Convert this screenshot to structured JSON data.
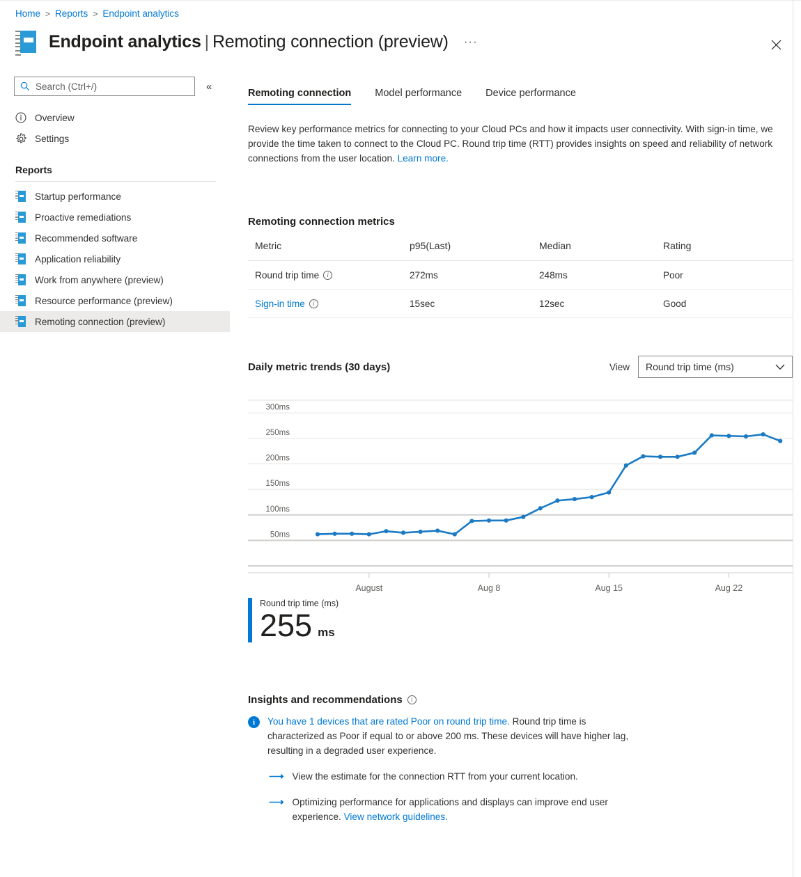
{
  "breadcrumb": [
    "Home",
    "Reports",
    "Endpoint analytics"
  ],
  "header": {
    "title": "Endpoint analytics",
    "separator": "|",
    "subtitle": "Remoting connection (preview)",
    "more_label": "···",
    "app_icon": "notebook-icon",
    "close_icon": "close-icon"
  },
  "sidebar": {
    "search": {
      "placeholder": "Search (Ctrl+/)",
      "value": "",
      "icon": "search-icon"
    },
    "collapse_label": "«",
    "top_items": [
      {
        "label": "Overview",
        "icon": "info-circle-icon"
      },
      {
        "label": "Settings",
        "icon": "gear-icon"
      }
    ],
    "section_title": "Reports",
    "report_items": [
      {
        "label": "Startup performance",
        "selected": false
      },
      {
        "label": "Proactive remediations",
        "selected": false
      },
      {
        "label": "Recommended software",
        "selected": false
      },
      {
        "label": "Application reliability",
        "selected": false
      },
      {
        "label": "Work from anywhere (preview)",
        "selected": false
      },
      {
        "label": "Resource performance (preview)",
        "selected": false
      },
      {
        "label": "Remoting connection (preview)",
        "selected": true
      }
    ]
  },
  "main": {
    "tabs": [
      {
        "label": "Remoting connection",
        "active": true
      },
      {
        "label": "Model performance",
        "active": false
      },
      {
        "label": "Device performance",
        "active": false
      }
    ],
    "intro": {
      "text": "Review key performance metrics for connecting to your Cloud PCs and how it impacts user connectivity. With sign-in time, we provide the time taken to connect to the Cloud PC. Round trip time (RTT) provides insights on speed and reliability of network connections from the user location.",
      "link": "Learn more."
    },
    "metrics": {
      "title": "Remoting connection metrics",
      "columns": [
        "Metric",
        "p95(Last)",
        "Median",
        "Rating"
      ],
      "rows": [
        {
          "metric": "Round trip time",
          "has_info": true,
          "is_link": false,
          "p95": "272ms",
          "median": "248ms",
          "rating": "Poor"
        },
        {
          "metric": "Sign-in time",
          "has_info": true,
          "is_link": true,
          "p95": "15sec",
          "median": "12sec",
          "rating": "Good"
        }
      ]
    },
    "trends": {
      "title": "Daily metric trends (30 days)",
      "view_label": "View",
      "selected_view": "Round trip time (ms)",
      "dropdown_icon": "chevron-down-icon"
    },
    "kpi": {
      "label": "Round trip time (ms)",
      "value": "255",
      "unit": "ms",
      "accent_color": "#0078d4"
    },
    "insights": {
      "title": "Insights and recommendations",
      "has_info": true,
      "alert_icon": "info-icon",
      "alert_link": "You have 1 devices that are rated Poor on round trip time.",
      "alert_rest": " Round trip time is characterized as Poor if equal to or above 200 ms. These devices will have higher lag, resulting in a degraded user experience.",
      "recommendations": [
        {
          "text": "View the estimate for the connection RTT from your current location.",
          "link": ""
        },
        {
          "text": "Optimizing performance for applications and displays can improve end user experience. ",
          "link": "View network guidelines."
        }
      ]
    }
  },
  "colors": {
    "accent": "#0078d4",
    "chart_line": "#1a7ac4",
    "link": "#0078d4",
    "icon_blue": "#2a9ad6"
  },
  "chart_data": {
    "type": "line",
    "title": "Daily metric trends (30 days)",
    "xlabel": "",
    "ylabel": "",
    "ylim": [
      0,
      325
    ],
    "grid": true,
    "legend": "none",
    "y_ticks": [
      50,
      100,
      150,
      200,
      250,
      300
    ],
    "y_tick_labels": [
      "50ms",
      "100ms",
      "150ms",
      "200ms",
      "250ms",
      "300ms"
    ],
    "x_tick_labels": [
      "August",
      "Aug 8",
      "Aug 15",
      "Aug 22"
    ],
    "x_tick_indices": [
      3,
      10,
      17,
      24
    ],
    "series": [
      {
        "name": "Round trip time (ms)",
        "color": "#1a7ac4",
        "values": [
          62,
          63,
          63,
          62,
          68,
          65,
          67,
          69,
          62,
          88,
          89,
          89,
          96,
          113,
          128,
          131,
          135,
          144,
          197,
          215,
          214,
          214,
          222,
          256,
          255,
          254,
          258,
          245
        ]
      }
    ]
  }
}
